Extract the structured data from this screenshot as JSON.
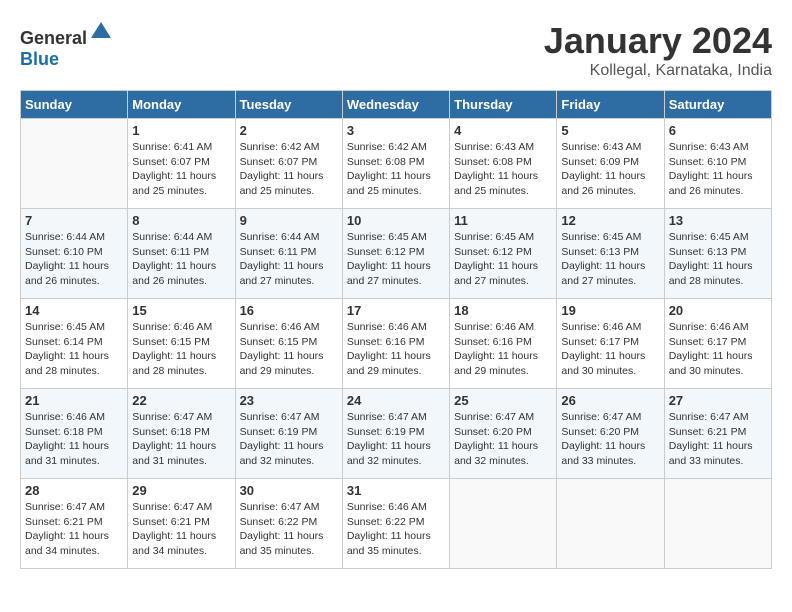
{
  "header": {
    "logo_general": "General",
    "logo_blue": "Blue",
    "month": "January 2024",
    "location": "Kollegal, Karnataka, India"
  },
  "days_of_week": [
    "Sunday",
    "Monday",
    "Tuesday",
    "Wednesday",
    "Thursday",
    "Friday",
    "Saturday"
  ],
  "weeks": [
    [
      {
        "day": "",
        "sunrise": "",
        "sunset": "",
        "daylight": ""
      },
      {
        "day": "1",
        "sunrise": "Sunrise: 6:41 AM",
        "sunset": "Sunset: 6:07 PM",
        "daylight": "Daylight: 11 hours and 25 minutes."
      },
      {
        "day": "2",
        "sunrise": "Sunrise: 6:42 AM",
        "sunset": "Sunset: 6:07 PM",
        "daylight": "Daylight: 11 hours and 25 minutes."
      },
      {
        "day": "3",
        "sunrise": "Sunrise: 6:42 AM",
        "sunset": "Sunset: 6:08 PM",
        "daylight": "Daylight: 11 hours and 25 minutes."
      },
      {
        "day": "4",
        "sunrise": "Sunrise: 6:43 AM",
        "sunset": "Sunset: 6:08 PM",
        "daylight": "Daylight: 11 hours and 25 minutes."
      },
      {
        "day": "5",
        "sunrise": "Sunrise: 6:43 AM",
        "sunset": "Sunset: 6:09 PM",
        "daylight": "Daylight: 11 hours and 26 minutes."
      },
      {
        "day": "6",
        "sunrise": "Sunrise: 6:43 AM",
        "sunset": "Sunset: 6:10 PM",
        "daylight": "Daylight: 11 hours and 26 minutes."
      }
    ],
    [
      {
        "day": "7",
        "sunrise": "Sunrise: 6:44 AM",
        "sunset": "Sunset: 6:10 PM",
        "daylight": "Daylight: 11 hours and 26 minutes."
      },
      {
        "day": "8",
        "sunrise": "Sunrise: 6:44 AM",
        "sunset": "Sunset: 6:11 PM",
        "daylight": "Daylight: 11 hours and 26 minutes."
      },
      {
        "day": "9",
        "sunrise": "Sunrise: 6:44 AM",
        "sunset": "Sunset: 6:11 PM",
        "daylight": "Daylight: 11 hours and 27 minutes."
      },
      {
        "day": "10",
        "sunrise": "Sunrise: 6:45 AM",
        "sunset": "Sunset: 6:12 PM",
        "daylight": "Daylight: 11 hours and 27 minutes."
      },
      {
        "day": "11",
        "sunrise": "Sunrise: 6:45 AM",
        "sunset": "Sunset: 6:12 PM",
        "daylight": "Daylight: 11 hours and 27 minutes."
      },
      {
        "day": "12",
        "sunrise": "Sunrise: 6:45 AM",
        "sunset": "Sunset: 6:13 PM",
        "daylight": "Daylight: 11 hours and 27 minutes."
      },
      {
        "day": "13",
        "sunrise": "Sunrise: 6:45 AM",
        "sunset": "Sunset: 6:13 PM",
        "daylight": "Daylight: 11 hours and 28 minutes."
      }
    ],
    [
      {
        "day": "14",
        "sunrise": "Sunrise: 6:45 AM",
        "sunset": "Sunset: 6:14 PM",
        "daylight": "Daylight: 11 hours and 28 minutes."
      },
      {
        "day": "15",
        "sunrise": "Sunrise: 6:46 AM",
        "sunset": "Sunset: 6:15 PM",
        "daylight": "Daylight: 11 hours and 28 minutes."
      },
      {
        "day": "16",
        "sunrise": "Sunrise: 6:46 AM",
        "sunset": "Sunset: 6:15 PM",
        "daylight": "Daylight: 11 hours and 29 minutes."
      },
      {
        "day": "17",
        "sunrise": "Sunrise: 6:46 AM",
        "sunset": "Sunset: 6:16 PM",
        "daylight": "Daylight: 11 hours and 29 minutes."
      },
      {
        "day": "18",
        "sunrise": "Sunrise: 6:46 AM",
        "sunset": "Sunset: 6:16 PM",
        "daylight": "Daylight: 11 hours and 29 minutes."
      },
      {
        "day": "19",
        "sunrise": "Sunrise: 6:46 AM",
        "sunset": "Sunset: 6:17 PM",
        "daylight": "Daylight: 11 hours and 30 minutes."
      },
      {
        "day": "20",
        "sunrise": "Sunrise: 6:46 AM",
        "sunset": "Sunset: 6:17 PM",
        "daylight": "Daylight: 11 hours and 30 minutes."
      }
    ],
    [
      {
        "day": "21",
        "sunrise": "Sunrise: 6:46 AM",
        "sunset": "Sunset: 6:18 PM",
        "daylight": "Daylight: 11 hours and 31 minutes."
      },
      {
        "day": "22",
        "sunrise": "Sunrise: 6:47 AM",
        "sunset": "Sunset: 6:18 PM",
        "daylight": "Daylight: 11 hours and 31 minutes."
      },
      {
        "day": "23",
        "sunrise": "Sunrise: 6:47 AM",
        "sunset": "Sunset: 6:19 PM",
        "daylight": "Daylight: 11 hours and 32 minutes."
      },
      {
        "day": "24",
        "sunrise": "Sunrise: 6:47 AM",
        "sunset": "Sunset: 6:19 PM",
        "daylight": "Daylight: 11 hours and 32 minutes."
      },
      {
        "day": "25",
        "sunrise": "Sunrise: 6:47 AM",
        "sunset": "Sunset: 6:20 PM",
        "daylight": "Daylight: 11 hours and 32 minutes."
      },
      {
        "day": "26",
        "sunrise": "Sunrise: 6:47 AM",
        "sunset": "Sunset: 6:20 PM",
        "daylight": "Daylight: 11 hours and 33 minutes."
      },
      {
        "day": "27",
        "sunrise": "Sunrise: 6:47 AM",
        "sunset": "Sunset: 6:21 PM",
        "daylight": "Daylight: 11 hours and 33 minutes."
      }
    ],
    [
      {
        "day": "28",
        "sunrise": "Sunrise: 6:47 AM",
        "sunset": "Sunset: 6:21 PM",
        "daylight": "Daylight: 11 hours and 34 minutes."
      },
      {
        "day": "29",
        "sunrise": "Sunrise: 6:47 AM",
        "sunset": "Sunset: 6:21 PM",
        "daylight": "Daylight: 11 hours and 34 minutes."
      },
      {
        "day": "30",
        "sunrise": "Sunrise: 6:47 AM",
        "sunset": "Sunset: 6:22 PM",
        "daylight": "Daylight: 11 hours and 35 minutes."
      },
      {
        "day": "31",
        "sunrise": "Sunrise: 6:46 AM",
        "sunset": "Sunset: 6:22 PM",
        "daylight": "Daylight: 11 hours and 35 minutes."
      },
      {
        "day": "",
        "sunrise": "",
        "sunset": "",
        "daylight": ""
      },
      {
        "day": "",
        "sunrise": "",
        "sunset": "",
        "daylight": ""
      },
      {
        "day": "",
        "sunrise": "",
        "sunset": "",
        "daylight": ""
      }
    ]
  ]
}
